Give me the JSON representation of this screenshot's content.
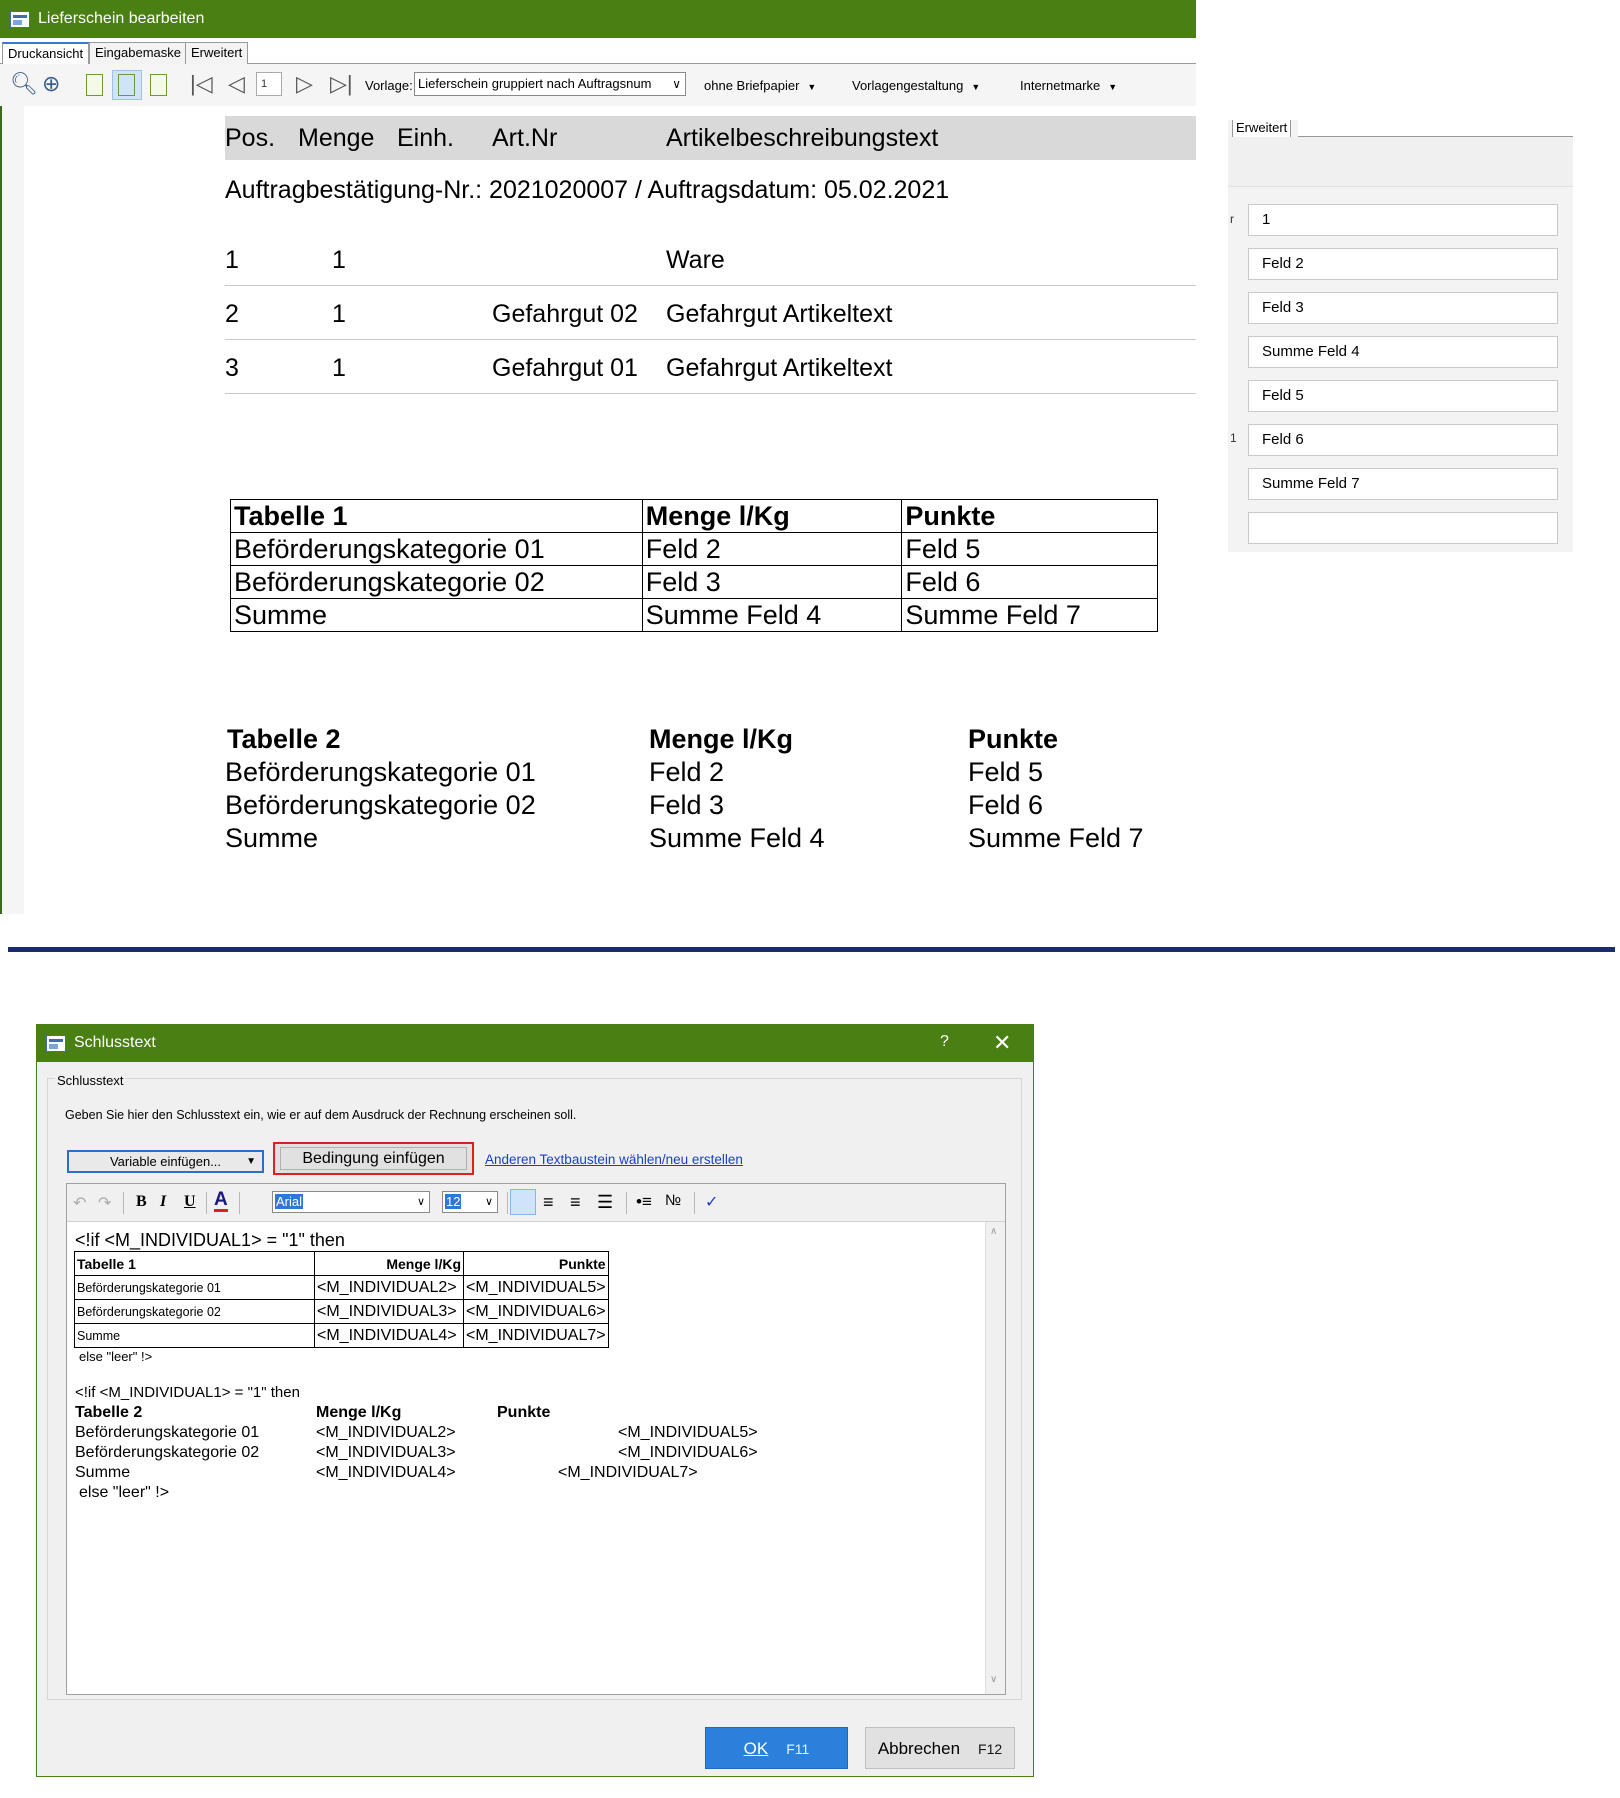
{
  "top_window": {
    "title": "Lieferschein bearbeiten",
    "tabs": [
      "Druckansicht",
      "Eingabemaske",
      "Erweitert"
    ],
    "toolbar": {
      "page_number": "1",
      "vorlage_label": "Vorlage:",
      "vorlage_value": "Lieferschein gruppiert nach Auftragsnum",
      "menu_briefpapier": "ohne Briefpapier",
      "menu_vorlagengestaltung": "Vorlagengestaltung",
      "menu_internetmarke": "Internetmarke"
    },
    "document": {
      "headers": [
        "Pos.",
        "Menge",
        "Einh.",
        "Art.Nr",
        "Artikelbeschreibungstext"
      ],
      "auftrag_line": "Auftragbestätigung-Nr.: 2021020007  /  Auftragsdatum: 05.02.2021",
      "items": [
        {
          "pos": "1",
          "menge": "1",
          "artnr": "",
          "text": "Ware"
        },
        {
          "pos": "2",
          "menge": "1",
          "artnr": "Gefahrgut 02",
          "text": "Gefahrgut Artikeltext"
        },
        {
          "pos": "3",
          "menge": "1",
          "artnr": "Gefahrgut 01",
          "text": "Gefahrgut Artikeltext"
        }
      ],
      "table1": [
        [
          "Tabelle 1",
          "Menge l/Kg",
          "Punkte"
        ],
        [
          "Beförderungskategorie 01",
          "Feld 2",
          "Feld 5"
        ],
        [
          "Beförderungskategorie 02",
          "Feld 3",
          "Feld 6"
        ],
        [
          "Summe",
          "Summe Feld 4",
          "Summe Feld 7"
        ]
      ],
      "table2": [
        [
          "Tabelle 2",
          "Menge l/Kg",
          "Punkte"
        ],
        [
          "Beförderungskategorie 01",
          "Feld 2",
          "Feld 5"
        ],
        [
          "Beförderungskategorie 02",
          "Feld 3",
          "Feld 6"
        ],
        [
          "Summe",
          "Summe Feld 4",
          "Summe Feld 7"
        ]
      ]
    }
  },
  "right_panel": {
    "tab": "Erweitert",
    "fields": [
      "1",
      "Feld 2",
      "Feld 3",
      "Summe Feld 4",
      "Feld 5",
      "Feld 6",
      "Summe Feld 7",
      ""
    ],
    "marks": [
      "r",
      "1"
    ]
  },
  "dialog": {
    "title": "Schlusstext",
    "help": "?",
    "close": "✕",
    "group_label": "Schlusstext",
    "instruction": "Geben Sie hier den Schlusstext ein, wie er auf dem Ausdruck der Rechnung erscheinen soll.",
    "variable_button": "Variable einfügen...",
    "condition_button": "Bedingung einfügen",
    "textbaustein_link": "Anderen Textbaustein wählen/neu erstellen",
    "font": "Arial",
    "font_size": "12",
    "editor": {
      "if1": "<!if <M_INDIVIDUAL1> = \"1\" then",
      "table1": [
        [
          "Tabelle 1",
          "Menge l/Kg",
          "Punkte"
        ],
        [
          "Beförderungskategorie 01",
          "<M_INDIVIDUAL2>",
          "<M_INDIVIDUAL5>"
        ],
        [
          "Beförderungskategorie 02",
          "<M_INDIVIDUAL3>",
          "<M_INDIVIDUAL6>"
        ],
        [
          "Summe",
          "<M_INDIVIDUAL4>",
          "<M_INDIVIDUAL7>"
        ]
      ],
      "else1": "else \"leer\" !>",
      "if2": "<!if <M_INDIVIDUAL1> = \"1\" then",
      "table2": [
        [
          "Tabelle 2",
          "Menge l/Kg",
          "Punkte"
        ],
        [
          "Beförderungskategorie 01",
          "<M_INDIVIDUAL2>",
          "<M_INDIVIDUAL5>"
        ],
        [
          "Beförderungskategorie 02",
          "<M_INDIVIDUAL3>",
          "<M_INDIVIDUAL6>"
        ],
        [
          "Summe",
          "<M_INDIVIDUAL4>",
          "<M_INDIVIDUAL7>"
        ]
      ],
      "else2": "else \"leer\" !>"
    },
    "ok": {
      "label": "OK",
      "key": "F11"
    },
    "cancel": {
      "label": "Abbrechen",
      "key": "F12"
    }
  },
  "colors": {
    "titlebar": "#4a7f14",
    "divider": "#1a2c6e",
    "ok_button": "#2b80dc",
    "highlight_border": "#e02020"
  }
}
